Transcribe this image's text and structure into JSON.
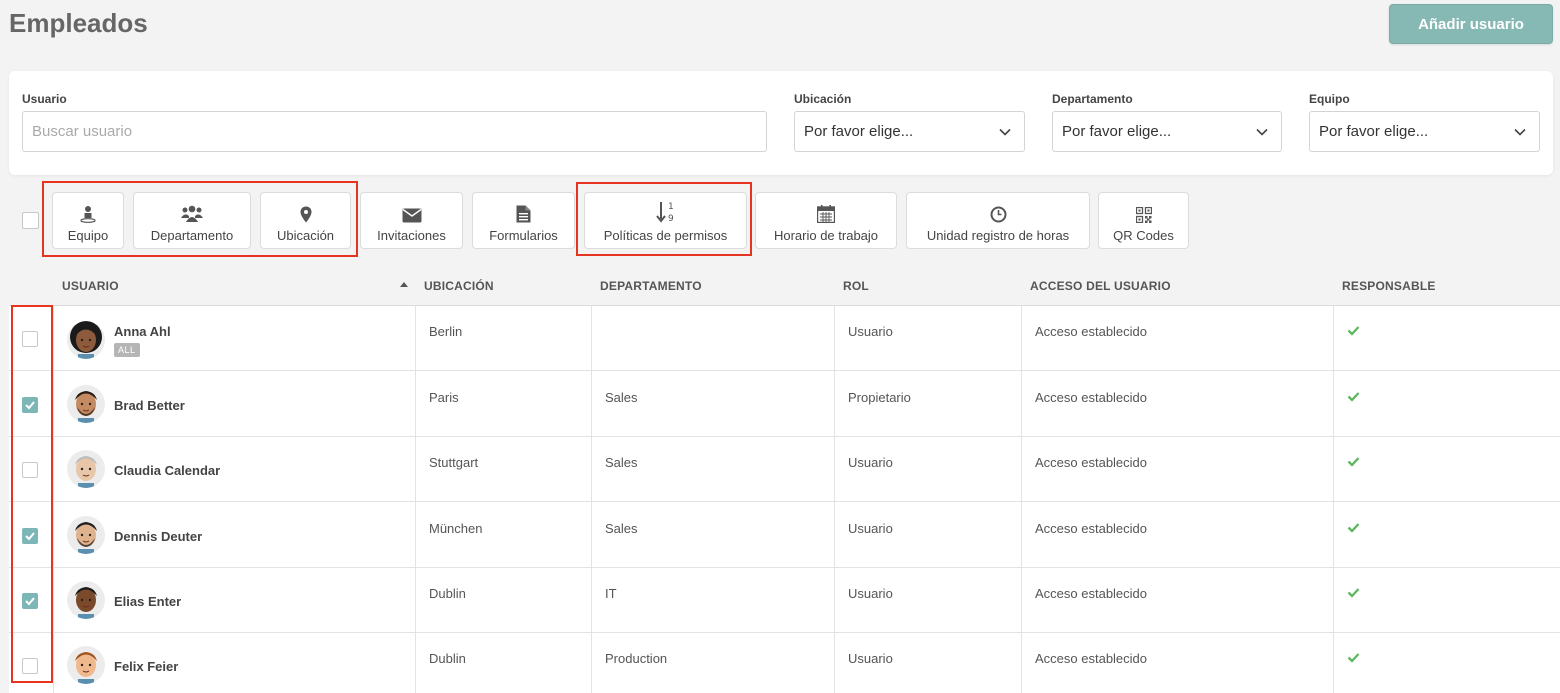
{
  "header": {
    "title": "Empleados",
    "add_user_label": "Añadir usuario"
  },
  "filters": {
    "user_label": "Usuario",
    "user_placeholder": "Buscar usuario",
    "location_label": "Ubicación",
    "location_value": "Por favor elige...",
    "department_label": "Departamento",
    "department_value": "Por favor elige...",
    "team_label": "Equipo",
    "team_value": "Por favor elige..."
  },
  "toolbar": {
    "buttons": [
      {
        "label": "Equipo",
        "icon": "person-icon"
      },
      {
        "label": "Departamento",
        "icon": "users-icon"
      },
      {
        "label": "Ubicación",
        "icon": "map-pin-icon"
      },
      {
        "label": "Invitaciones",
        "icon": "envelope-icon"
      },
      {
        "label": "Formularios",
        "icon": "document-icon"
      },
      {
        "label": "Políticas de permisos",
        "icon": "sort-numeric-icon"
      },
      {
        "label": "Horario de trabajo",
        "icon": "calendar-icon"
      },
      {
        "label": "Unidad registro de horas",
        "icon": "clock-icon"
      },
      {
        "label": "QR Codes",
        "icon": "qr-code-icon"
      }
    ]
  },
  "table": {
    "columns": [
      "USUARIO",
      "UBICACIÓN",
      "DEPARTAMENTO",
      "ROL",
      "ACCESO DEL USUARIO",
      "RESPONSABLE"
    ],
    "rows": [
      {
        "name": "Anna Ahl",
        "badge": "ALL",
        "location": "Berlin",
        "department": "",
        "role": "Usuario",
        "access": "Acceso establecido",
        "checked": false
      },
      {
        "name": "Brad Better",
        "location": "Paris",
        "department": "Sales",
        "role": "Propietario",
        "access": "Acceso establecido",
        "checked": true
      },
      {
        "name": "Claudia Calendar",
        "location": "Stuttgart",
        "department": "Sales",
        "role": "Usuario",
        "access": "Acceso establecido",
        "checked": false
      },
      {
        "name": "Dennis Deuter",
        "location": "München",
        "department": "Sales",
        "role": "Usuario",
        "access": "Acceso establecido",
        "checked": true
      },
      {
        "name": "Elias Enter",
        "location": "Dublin",
        "department": "IT",
        "role": "Usuario",
        "access": "Acceso establecido",
        "checked": true
      },
      {
        "name": "Felix Feier",
        "location": "Dublin",
        "department": "Production",
        "role": "Usuario",
        "access": "Acceso establecido",
        "checked": false
      }
    ]
  },
  "colors": {
    "accent": "#86b8b4",
    "highlight": "#e5341f",
    "check": "#5cb85c"
  }
}
